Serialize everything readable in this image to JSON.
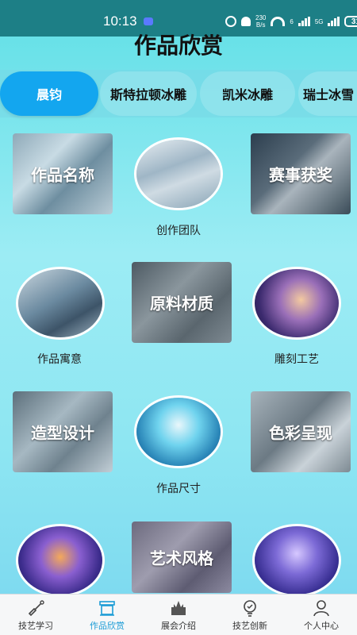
{
  "status_bar": {
    "time": "10:13",
    "network_speed_top": "230",
    "network_speed_bottom": "B/s",
    "signal_label": "6",
    "network_type": "5G",
    "battery": "31"
  },
  "page_title": "作品欣赏",
  "tabs": [
    {
      "label": "晨钧",
      "active": true
    },
    {
      "label": "斯特拉顿冰雕",
      "active": false
    },
    {
      "label": "凯米冰雕",
      "active": false
    },
    {
      "label": "瑞士冰雪",
      "active": false
    }
  ],
  "grid": {
    "row1": {
      "left_label": "作品名称",
      "center_caption": "创作团队",
      "right_label": "赛事获奖"
    },
    "row2": {
      "left_caption": "作品寓意",
      "center_label": "原料材质",
      "right_caption": "雕刻工艺"
    },
    "row3": {
      "left_label": "造型设计",
      "center_caption": "作品尺寸",
      "right_label": "色彩呈现"
    },
    "row4": {
      "center_label": "艺术风格"
    }
  },
  "bottom_nav": [
    {
      "label": "技艺学习",
      "icon": "shovel-icon",
      "active": false
    },
    {
      "label": "作品欣赏",
      "icon": "gallery-icon",
      "active": true
    },
    {
      "label": "展会介绍",
      "icon": "castle-icon",
      "active": false
    },
    {
      "label": "技艺创新",
      "icon": "lightbulb-icon",
      "active": false
    },
    {
      "label": "个人中心",
      "icon": "person-icon",
      "active": false
    }
  ],
  "colors": {
    "status_bar": "#1d7f86",
    "active_tab": "#13a6ef",
    "active_nav": "#1a9bd6"
  }
}
